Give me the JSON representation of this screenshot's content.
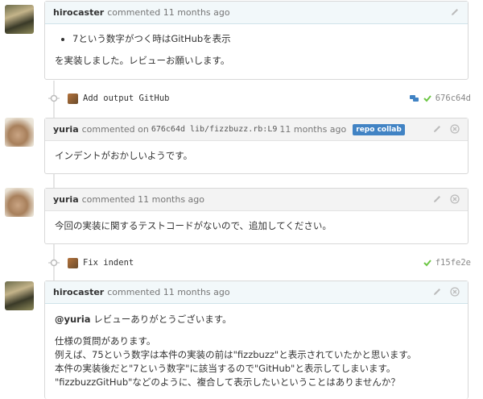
{
  "comments": [
    {
      "author": "hirocaster",
      "meta": "commented 11 months ago",
      "bullet": "7という数字がつく時はGitHubを表示",
      "text": "を実装しました。レビューお願いします。"
    },
    {
      "author": "yuria",
      "meta_prefix": "commented on",
      "commit": "676c64d",
      "file": "lib/fizzbuzz.rb:L9",
      "time": "11 months ago",
      "badge": "repo collab",
      "text": "インデントがおかしいようです。"
    },
    {
      "author": "yuria",
      "meta": "commented 11 months ago",
      "text": "今回の実装に関するテストコードがないので、追加してください。"
    },
    {
      "author": "hirocaster",
      "meta": "commented 11 months ago",
      "mention": "@yuria",
      "line1": "レビューありがとうございます。",
      "line2": "仕様の質問があります。",
      "line3": "例えば、75という数字は本件の実装の前は\"fizzbuzz\"と表示されていたかと思います。",
      "line4": "本件の実装後だと\"7という数字\"に該当するので\"GitHub\"と表示してしまいます。",
      "line5": "\"fizzbuzzGitHub\"などのように、複合して表示したいということはありませんか？"
    }
  ],
  "commits": [
    {
      "message": "Add output GitHub",
      "sha": "676c64d"
    },
    {
      "message": "Fix indent",
      "sha": "f15fe2e"
    }
  ],
  "colors": {
    "check": "#6cc644",
    "link": "#4183c4"
  }
}
